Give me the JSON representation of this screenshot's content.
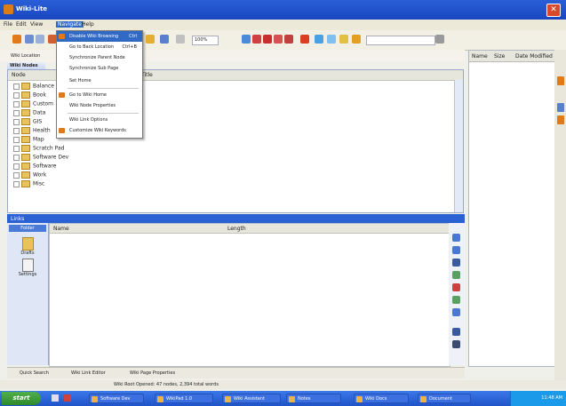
{
  "window": {
    "title": "Wiki-Lite"
  },
  "menubar": {
    "items": [
      "File",
      "Edit",
      "View",
      "Navigate",
      "Help"
    ],
    "active_index": 3
  },
  "toolbar": {
    "zoom_value": "100%",
    "search_placeholder": ""
  },
  "nav_menu": {
    "items": [
      {
        "label": "Disable Wiki Browsing",
        "shortcut": "Ctrl",
        "highlight": true,
        "icon": true
      },
      {
        "label": "Go to Back Location",
        "shortcut": "Ctrl+B",
        "icon": false
      },
      {
        "label": "Synchronize Parent Node",
        "shortcut": "",
        "icon": false
      },
      {
        "label": "Synchronize Sub Page",
        "shortcut": "",
        "icon": false
      },
      {
        "label": "Set Home",
        "shortcut": "",
        "icon": false
      },
      {
        "label": "Go to Wiki Home",
        "shortcut": "",
        "icon": true
      },
      {
        "label": "Wiki Node Properties",
        "shortcut": "",
        "icon": false
      },
      {
        "label": "Wiki Link Options",
        "shortcut": "",
        "icon": false
      },
      {
        "label": "Customize Wiki Keywords",
        "shortcut": "",
        "icon": true
      }
    ]
  },
  "address": {
    "label": "Wiki Location",
    "value": ""
  },
  "tree_panel": {
    "tab_label": "Wiki Nodes",
    "columns": [
      "Node",
      "Title"
    ],
    "rows": [
      "Balance",
      "Book",
      "Custom",
      "Data",
      "GIS",
      "Health",
      "Map",
      "Scratch Pad",
      "Software Dev",
      "Software",
      "Work",
      "Misc"
    ]
  },
  "right_panel": {
    "columns": [
      "Name",
      "Size",
      "Date Modified"
    ]
  },
  "bottom_panel": {
    "title": "Links",
    "nav_tab": "Folder",
    "nav_items": [
      "Drafts",
      "Settings"
    ],
    "columns": [
      "Name",
      "Length"
    ]
  },
  "bottom_tabs": [
    "Quick Search",
    "Wiki Link Editor",
    "Wiki Page Properties"
  ],
  "status": {
    "message": "Wiki Root Opened: 47 nodes, 2,394 total words"
  },
  "taskbar": {
    "start_label": "start",
    "tasks": [
      "Software Dev",
      "WikiPad 1.0",
      "Wiki Assistant",
      "Notes",
      "Wiki Docs",
      "Document"
    ],
    "clock": "11:48 AM"
  },
  "colors": {
    "titlebar": "#1a46c0",
    "accent": "#316ac5",
    "taskbar": "#1f54c8",
    "start": "#2f8a2a"
  }
}
